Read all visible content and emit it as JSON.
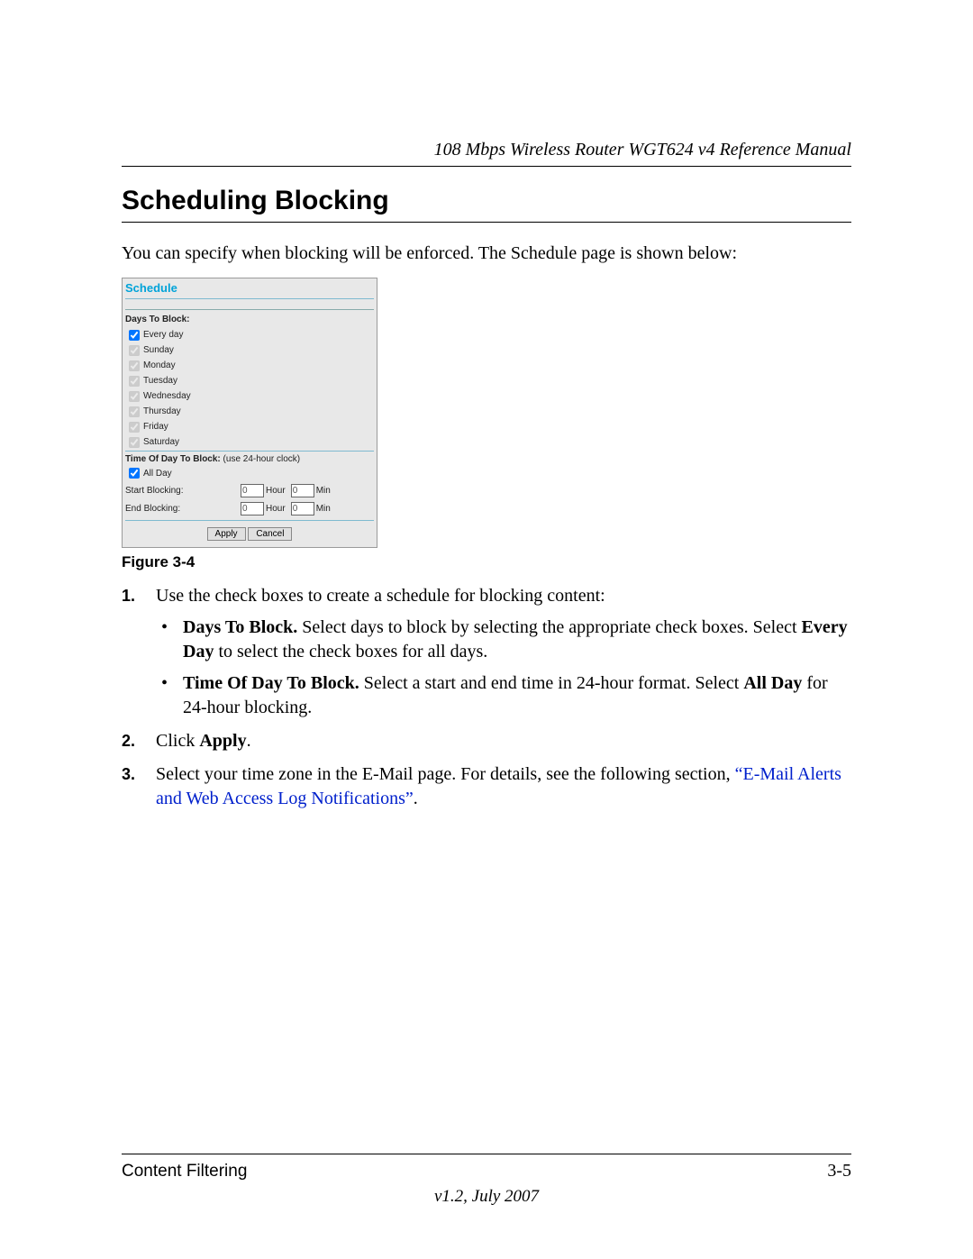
{
  "header": {
    "doc_title": "108 Mbps Wireless Router WGT624 v4 Reference Manual"
  },
  "section": {
    "heading": "Scheduling Blocking",
    "intro": "You can specify when blocking will be enforced. The Schedule page is shown below:",
    "figure_caption": "Figure 3-4"
  },
  "router_ui": {
    "title": "Schedule",
    "days_label": "Days To Block:",
    "days": [
      {
        "label": "Every day",
        "checked": true,
        "disabled": false
      },
      {
        "label": "Sunday",
        "checked": true,
        "disabled": true
      },
      {
        "label": "Monday",
        "checked": true,
        "disabled": true
      },
      {
        "label": "Tuesday",
        "checked": true,
        "disabled": true
      },
      {
        "label": "Wednesday",
        "checked": true,
        "disabled": true
      },
      {
        "label": "Thursday",
        "checked": true,
        "disabled": true
      },
      {
        "label": "Friday",
        "checked": true,
        "disabled": true
      },
      {
        "label": "Saturday",
        "checked": true,
        "disabled": true
      }
    ],
    "time_label_bold": "Time Of Day To Block:",
    "time_label_hint": "(use 24-hour clock)",
    "all_day_label": "All Day",
    "all_day_checked": true,
    "start_label": "Start Blocking:",
    "end_label": "End Blocking:",
    "start_hour": "0",
    "start_min": "0",
    "end_hour": "0",
    "end_min": "0",
    "unit_hour": "Hour",
    "unit_min": "Min",
    "apply_label": "Apply",
    "cancel_label": "Cancel"
  },
  "list": {
    "item1_num": "1.",
    "item1_text": "Use the check boxes to create a schedule for blocking content:",
    "b1_bold": "Days To Block.",
    "b1_text_a": " Select days to block by selecting the appropriate check boxes. Select ",
    "b1_bold2": "Every Day",
    "b1_text_b": " to select the check boxes for all days.",
    "b2_bold": "Time Of Day To Block.",
    "b2_text_a": " Select a start and end time in 24-hour format. Select ",
    "b2_bold2": "All Day",
    "b2_text_b": " for 24-hour blocking.",
    "item2_num": "2.",
    "item2_text_a": "Click ",
    "item2_bold": "Apply",
    "item2_text_b": ".",
    "item3_num": "3.",
    "item3_text_a": "Select your time zone in the E-Mail page. For details, see the following section, ",
    "item3_link": "“E-Mail Alerts and Web Access Log Notifications”",
    "item3_text_b": "."
  },
  "footer": {
    "left": "Content Filtering",
    "right": "3-5",
    "version": "v1.2, July 2007"
  }
}
